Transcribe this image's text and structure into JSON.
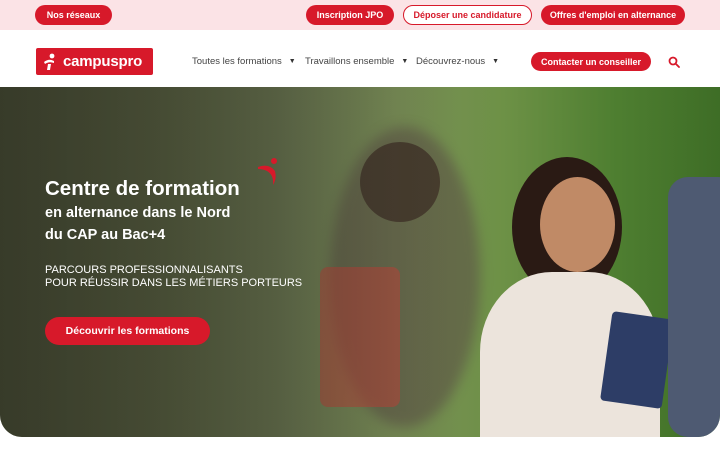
{
  "topbar": {
    "networks_label": "Nos réseaux",
    "jpo_label": "Inscription JPO",
    "apply_label": "Déposer une candidature",
    "jobs_label": "Offres d'emploi en alternance"
  },
  "header": {
    "logo_text": "campuspro",
    "nav": [
      {
        "label": "Toutes les formations"
      },
      {
        "label": "Travaillons ensemble"
      },
      {
        "label": "Découvrez-nous"
      }
    ],
    "contact_label": "Contacter un conseiller"
  },
  "hero": {
    "title": "Centre de formation",
    "subtitle_line1": "en alternance dans le Nord",
    "subtitle_line2": "du CAP au Bac+4",
    "tagline_line1": " PARCOURS PROFESSIONNALISANTS",
    "tagline_line2": "POUR RÉUSSIR DANS LES MÉTIERS PORTEURS",
    "cta_label": "Découvrir les formations"
  },
  "colors": {
    "brand_red": "#d7192a",
    "topbar_bg": "#fbe3e6"
  },
  "icons": {
    "logo_mark": "campuspro-mark-icon",
    "search": "search-icon",
    "caret": "caret-down-icon"
  }
}
